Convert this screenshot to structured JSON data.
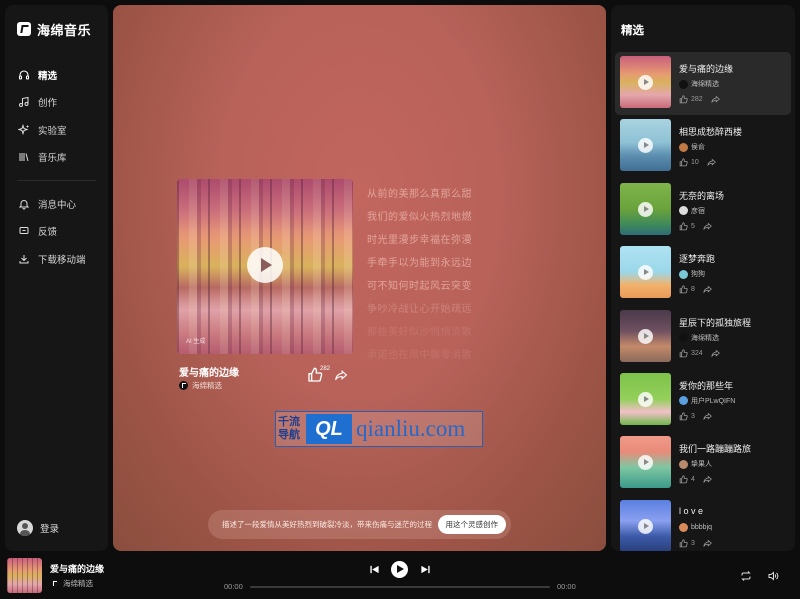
{
  "app": {
    "name": "海绵音乐"
  },
  "sidebar": {
    "items": [
      {
        "label": "精选",
        "icon": "headphones-icon",
        "active": true
      },
      {
        "label": "创作",
        "icon": "music-note-icon"
      },
      {
        "label": "实验室",
        "icon": "sparkle-icon"
      },
      {
        "label": "音乐库",
        "icon": "library-icon"
      }
    ],
    "secondary": [
      {
        "label": "消息中心",
        "icon": "bell-icon"
      },
      {
        "label": "反馈",
        "icon": "feedback-icon"
      },
      {
        "label": "下载移动端",
        "icon": "download-icon"
      }
    ],
    "login_label": "登录"
  },
  "now_showing": {
    "title": "爱与痛的边缘",
    "artist": "海绵精选",
    "ai_tag": "AI 生成",
    "likes": "282",
    "lyrics": [
      "从前的美那么真那么甜",
      "我们的爱似火热烈地燃",
      "时光里漫步幸福在弥漫",
      "手牵手以为能到永远边",
      "可不知何时起风云突变",
      "争吵冷战让心开始疏远",
      "那些美好似沙悄悄流散",
      "承诺也在风中飘零消散"
    ],
    "prompt": "描述了一段爱情从美好热烈到破裂冷淡，带来伤痛与迷茫的过程",
    "prompt_button": "用这个灵感创作"
  },
  "watermark": {
    "cn": "千流导航",
    "ql": "QL",
    "url": "qianliu.com"
  },
  "featured": {
    "title": "精选",
    "items": [
      {
        "title": "爱与痛的边缘",
        "author": "海绵精选",
        "likes": "282",
        "active": true,
        "thumb": "linear-gradient(180deg,#c95f7d 0%,#e79b72 35%,#d9b25c 50%,#e4a7ac 75%,#c86b79 100%)",
        "avatar": "#111111"
      },
      {
        "title": "相思成愁醉西楼",
        "author": "侯俞",
        "likes": "10",
        "thumb": "linear-gradient(180deg,#a9d3e0 0%,#8fc2d6 45%,#5d8fb0 70%,#3f6e93 100%)",
        "avatar": "#c27a45"
      },
      {
        "title": "无奈的离场",
        "author": "彦宿",
        "likes": "5",
        "thumb": "linear-gradient(180deg,#7fb54a 0%,#6aa33c 50%,#3e8a5a 80%,#2f6b7a 100%)",
        "avatar": "#dddddd"
      },
      {
        "title": "逐梦奔跑",
        "author": "狗狗",
        "likes": "8",
        "thumb": "linear-gradient(180deg,#aee3f2 0%,#9bd7ea 50%,#f2b26b 75%,#e9995a 100%)",
        "avatar": "#7ac9d6"
      },
      {
        "title": "星辰下的孤独旅程",
        "author": "海绵精选",
        "likes": "324",
        "thumb": "linear-gradient(180deg,#4a3a4a 0%,#6e5060 40%,#c48a6a 70%,#8a6a5a 100%)",
        "avatar": "#111111"
      },
      {
        "title": "爱你的那些年",
        "author": "用户PLwQIFN",
        "likes": "3",
        "thumb": "linear-gradient(180deg,#7ec24a 0%,#93d05a 50%,#f2c0c8 75%,#6fb84a 100%)",
        "avatar": "#5aa0e0"
      },
      {
        "title": "我们一路蹦蹦路旅",
        "author": "挚果人",
        "likes": "4",
        "thumb": "linear-gradient(180deg,#f09a8a 0%,#e98b7a 30%,#7fc7a2 60%,#3a9a8a 100%)",
        "avatar": "#b68a6a"
      },
      {
        "title": "l o v e",
        "author": "bbbbjq",
        "likes": "3",
        "thumb": "linear-gradient(180deg,#5a7fe0 0%,#8aa0f0 40%,#3c5aa8 70%,#2a3f7a 100%)",
        "avatar": "#d88a5a"
      }
    ]
  },
  "player": {
    "title": "爱与痛的边缘",
    "artist": "海绵精选",
    "time_current": "00:00",
    "time_total": "00:00",
    "progress": 0
  },
  "colors": {
    "accent": "#ffffff",
    "background": "#0d0d0d",
    "panel": "#161616"
  }
}
